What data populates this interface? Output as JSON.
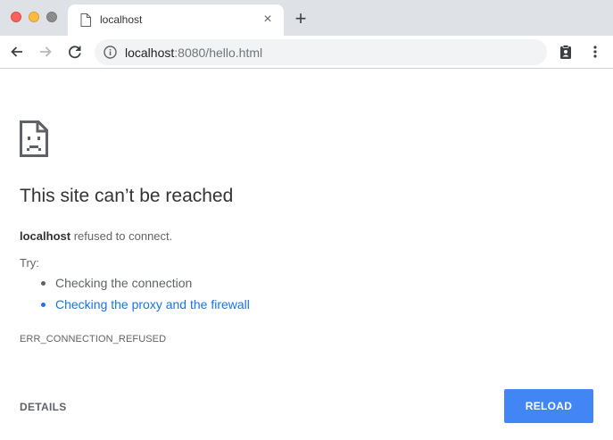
{
  "browser": {
    "tab": {
      "title": "localhost",
      "close_glyph": "×",
      "favicon": "page-icon"
    },
    "new_tab_glyph": "+",
    "toolbar": {
      "back": "back-arrow-icon",
      "forward": "forward-arrow-icon",
      "reload": "reload-icon",
      "profile": "clipboard-profile-icon",
      "menu": "kebab-menu-icon"
    },
    "omnibox": {
      "host": "localhost",
      "rest": ":8080/hello.html",
      "site_info": "info-icon"
    }
  },
  "error_page": {
    "icon": "sad-document-icon",
    "heading": "This site can’t be reached",
    "host": "localhost",
    "summary_rest": " refused to connect.",
    "try_label": "Try:",
    "suggestions": [
      {
        "text": "Checking the connection",
        "is_link": false
      },
      {
        "text": "Checking the proxy and the firewall",
        "is_link": true
      }
    ],
    "error_code": "ERR_CONNECTION_REFUSED",
    "details_label": "DETAILS",
    "reload_label": "RELOAD"
  },
  "colors": {
    "tabstrip_bg": "#dee1e6",
    "omnibox_bg": "#f1f3f4",
    "link": "#1a73e8",
    "reload_button": "#4285f4",
    "traffic_red": "#fc625d",
    "traffic_yellow": "#fdbc40"
  }
}
